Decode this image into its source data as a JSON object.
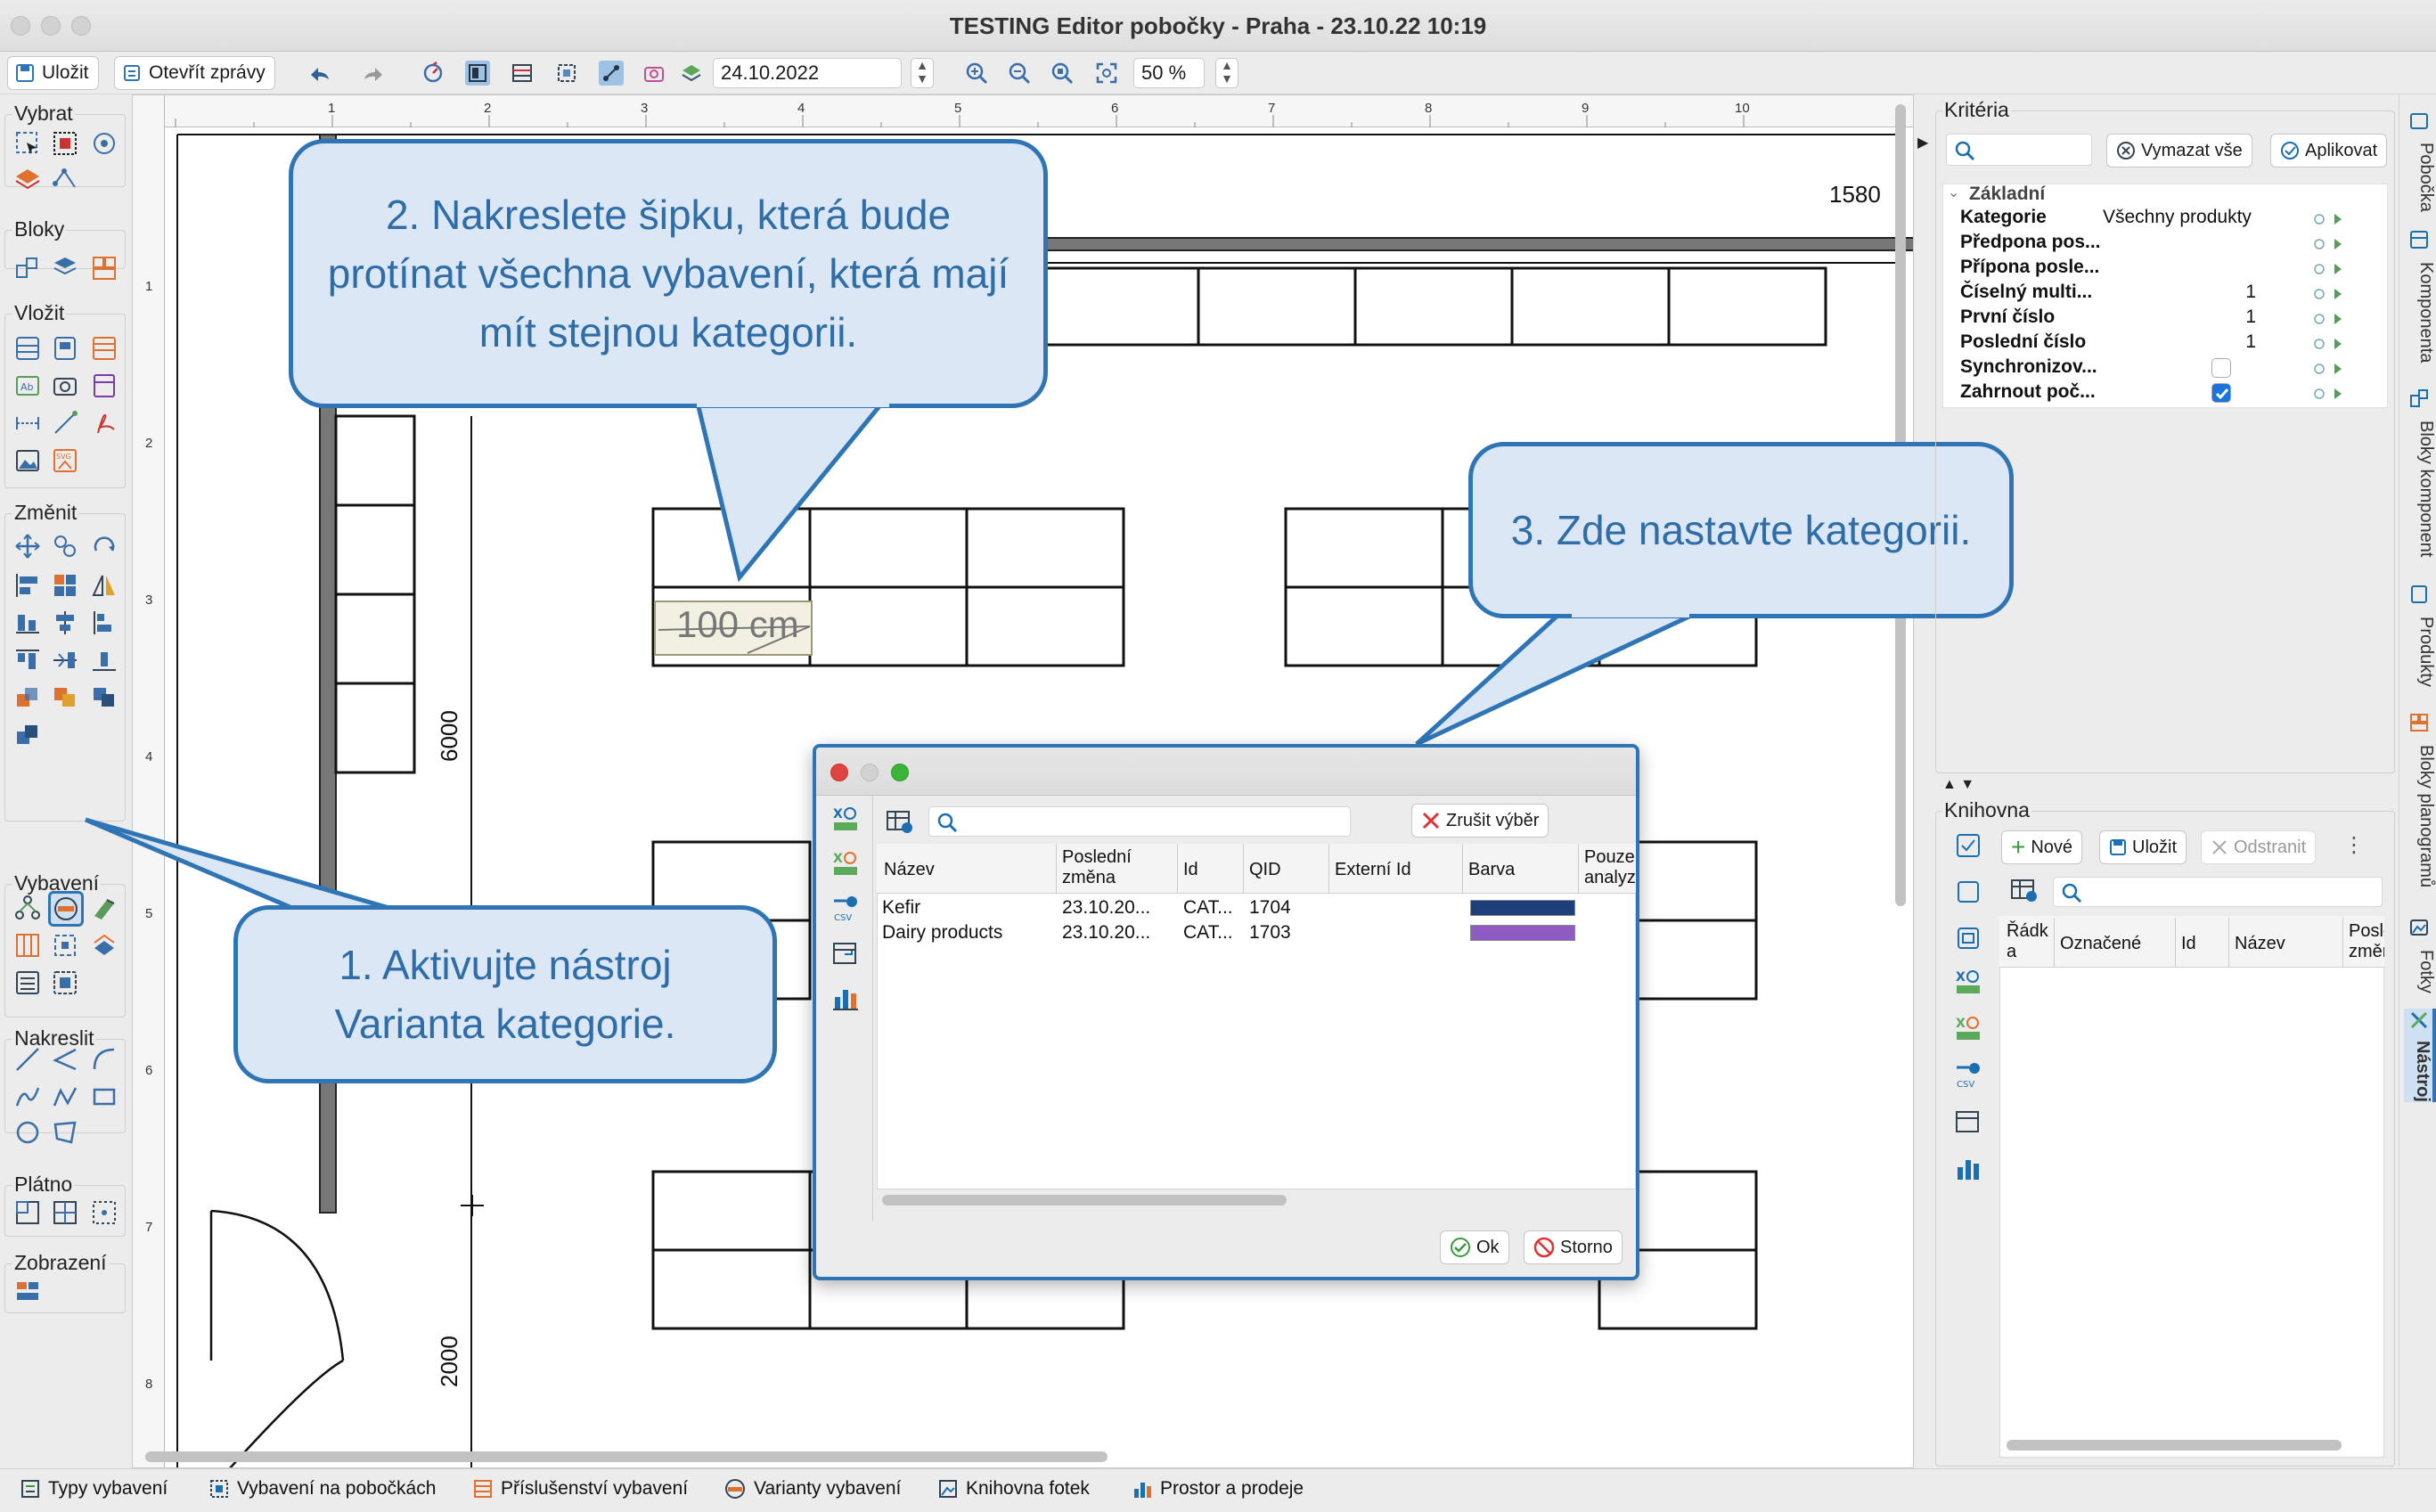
{
  "window": {
    "title": "TESTING Editor pobočky - Praha - 23.10.22 10:19"
  },
  "toolbar": {
    "save_label": "Uložit",
    "open_reports_label": "Otevřít zprávy",
    "date_value": "24.10.2022",
    "zoom_value": "50 %"
  },
  "palette": {
    "vybrat": "Vybrat",
    "bloky": "Bloky",
    "vlozit": "Vložit",
    "zmenit": "Změnit",
    "vybaveni": "Vybavení",
    "nakreslit": "Nakreslit",
    "platno": "Plátno",
    "zobrazeni": "Zobrazení"
  },
  "canvas": {
    "ruler_top": [
      "1",
      "2",
      "3",
      "4",
      "5",
      "6",
      "7",
      "8",
      "9",
      "10"
    ],
    "ruler_left": [
      "1",
      "2",
      "3",
      "4",
      "5",
      "6",
      "7",
      "8"
    ],
    "dim_6000": "6000",
    "dim_2000": "2000",
    "dim_1580": "1580",
    "arrow_label": "100 cm"
  },
  "dialog": {
    "search_placeholder": "",
    "clear_label": "Zrušit výběr",
    "columns": [
      "Název",
      "Poslední změna",
      "Id",
      "QID",
      "Externí Id",
      "Barva",
      "Pouze analyz"
    ],
    "rows": [
      {
        "name": "Kefir",
        "changed": "23.10.20...",
        "id": "CAT...",
        "qid": "1704",
        "color": "#1f3f7a"
      },
      {
        "name": "Dairy products",
        "changed": "23.10.20...",
        "id": "CAT...",
        "qid": "1703",
        "color": "#8e5bc2"
      }
    ],
    "ok_label": "Ok",
    "cancel_label": "Storno"
  },
  "criteria": {
    "title": "Kritéria",
    "clear_all": "Vymazat vše",
    "apply": "Aplikovat",
    "section": "Základní",
    "rows": [
      {
        "label": "Kategorie",
        "value": "Všechny produkty"
      },
      {
        "label": "Předpona pos...",
        "value": ""
      },
      {
        "label": "Přípona posle...",
        "value": ""
      },
      {
        "label": "Číselný multi...",
        "value": "1"
      },
      {
        "label": "První číslo",
        "value": "1"
      },
      {
        "label": "Poslední číslo",
        "value": "1"
      },
      {
        "label": "Synchronizov...",
        "value": ""
      },
      {
        "label": "Zahrnout poč...",
        "value": ""
      }
    ],
    "sync_checked": false,
    "include_checked": true
  },
  "library": {
    "title": "Knihovna",
    "new": "Nové",
    "save": "Uložit",
    "delete": "Odstranit",
    "columns": [
      "Řádk a",
      "Označené",
      "Id",
      "Název",
      "Posle změna"
    ]
  },
  "side_tabs": [
    "Pobočka",
    "Komponenta",
    "Bloky komponent",
    "Produkty",
    "Bloky planogramů",
    "Fotky",
    "Nástroj"
  ],
  "bottom_tabs": [
    "Typy vybavení",
    "Vybavení na pobočkách",
    "Příslušenství vybavení",
    "Varianty vybavení",
    "Knihovna fotek",
    "Prostor a prodeje"
  ],
  "callouts": {
    "c1": "1. Aktivujte nástroj Varianta kategorie.",
    "c2": "2. Nakreslete šipku, která bude protínat všechna vybavení, která mají mít stejnou kategorii.",
    "c3": "3. Zde nastavte kategorii."
  }
}
